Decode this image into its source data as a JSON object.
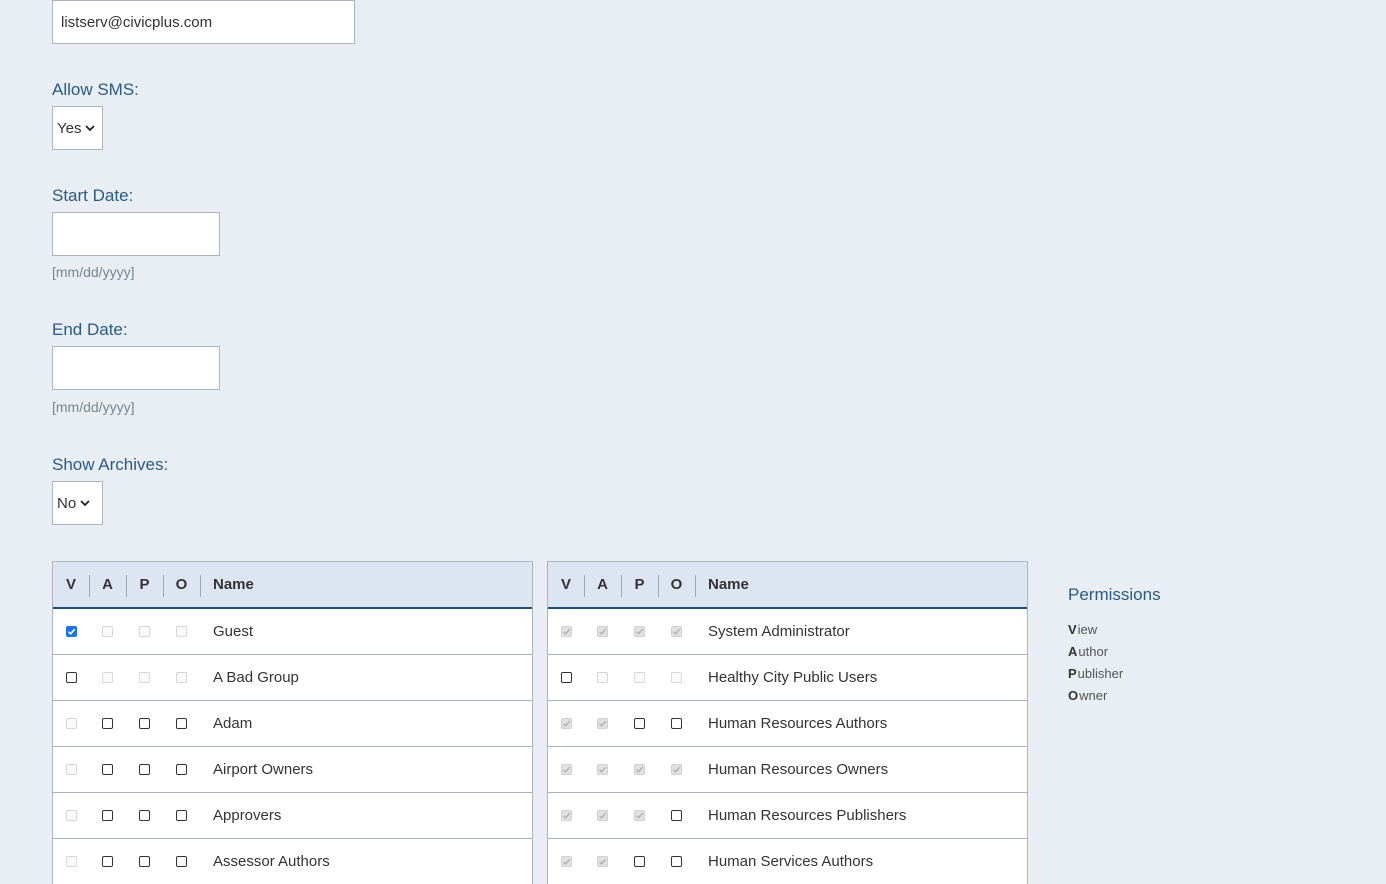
{
  "email": {
    "value": "listserv@civicplus.com"
  },
  "allow_sms": {
    "label": "Allow SMS:",
    "value": "Yes"
  },
  "start_date": {
    "label": "Start Date:",
    "value": "",
    "hint": "[mm/dd/yyyy]"
  },
  "end_date": {
    "label": "End Date:",
    "value": "",
    "hint": "[mm/dd/yyyy]"
  },
  "show_archives": {
    "label": "Show Archives:",
    "value": "No"
  },
  "table_headers": {
    "v": "V",
    "a": "A",
    "p": "P",
    "o": "O",
    "name": "Name"
  },
  "left_table": {
    "rows": [
      {
        "name": "Guest",
        "v": {
          "checked": true,
          "disabled": false
        },
        "a": {
          "checked": false,
          "disabled": true
        },
        "p": {
          "checked": false,
          "disabled": true
        },
        "o": {
          "checked": false,
          "disabled": true
        }
      },
      {
        "name": "A Bad Group",
        "v": {
          "checked": false,
          "disabled": false
        },
        "a": {
          "checked": false,
          "disabled": true
        },
        "p": {
          "checked": false,
          "disabled": true
        },
        "o": {
          "checked": false,
          "disabled": true
        }
      },
      {
        "name": "Adam",
        "v": {
          "checked": false,
          "disabled": true
        },
        "a": {
          "checked": false,
          "disabled": false
        },
        "p": {
          "checked": false,
          "disabled": false
        },
        "o": {
          "checked": false,
          "disabled": false
        }
      },
      {
        "name": "Airport Owners",
        "v": {
          "checked": false,
          "disabled": true
        },
        "a": {
          "checked": false,
          "disabled": false
        },
        "p": {
          "checked": false,
          "disabled": false
        },
        "o": {
          "checked": false,
          "disabled": false
        }
      },
      {
        "name": "Approvers",
        "v": {
          "checked": false,
          "disabled": true
        },
        "a": {
          "checked": false,
          "disabled": false
        },
        "p": {
          "checked": false,
          "disabled": false
        },
        "o": {
          "checked": false,
          "disabled": false
        }
      },
      {
        "name": "Assessor Authors",
        "v": {
          "checked": false,
          "disabled": true
        },
        "a": {
          "checked": false,
          "disabled": false
        },
        "p": {
          "checked": false,
          "disabled": false
        },
        "o": {
          "checked": false,
          "disabled": false
        }
      }
    ]
  },
  "right_table": {
    "rows": [
      {
        "name": "System Administrator",
        "v": {
          "checked": true,
          "disabled": true
        },
        "a": {
          "checked": true,
          "disabled": true
        },
        "p": {
          "checked": true,
          "disabled": true
        },
        "o": {
          "checked": true,
          "disabled": true
        }
      },
      {
        "name": "Healthy City Public Users",
        "v": {
          "checked": false,
          "disabled": false
        },
        "a": {
          "checked": false,
          "disabled": true
        },
        "p": {
          "checked": false,
          "disabled": true
        },
        "o": {
          "checked": false,
          "disabled": true
        }
      },
      {
        "name": "Human Resources Authors",
        "v": {
          "checked": true,
          "disabled": true
        },
        "a": {
          "checked": true,
          "disabled": true
        },
        "p": {
          "checked": false,
          "disabled": false
        },
        "o": {
          "checked": false,
          "disabled": false
        }
      },
      {
        "name": "Human Resources Owners",
        "v": {
          "checked": true,
          "disabled": true
        },
        "a": {
          "checked": true,
          "disabled": true
        },
        "p": {
          "checked": true,
          "disabled": true
        },
        "o": {
          "checked": true,
          "disabled": true
        }
      },
      {
        "name": "Human Resources Publishers",
        "v": {
          "checked": true,
          "disabled": true
        },
        "a": {
          "checked": true,
          "disabled": true
        },
        "p": {
          "checked": true,
          "disabled": true
        },
        "o": {
          "checked": false,
          "disabled": false
        }
      },
      {
        "name": "Human Services Authors",
        "v": {
          "checked": true,
          "disabled": true
        },
        "a": {
          "checked": true,
          "disabled": true
        },
        "p": {
          "checked": false,
          "disabled": false
        },
        "o": {
          "checked": false,
          "disabled": false
        }
      }
    ]
  },
  "legend": {
    "title": "Permissions",
    "items": [
      {
        "key": "V",
        "rest": "iew"
      },
      {
        "key": "A",
        "rest": "uthor"
      },
      {
        "key": "P",
        "rest": "ublisher"
      },
      {
        "key": "O",
        "rest": "wner"
      }
    ]
  },
  "colors": {
    "background": "#e8eef3",
    "label": "#2a5b84",
    "header_bg": "#dce5f1",
    "header_border": "#1f4d7a",
    "checkbox_checked": "#1a73e8"
  }
}
